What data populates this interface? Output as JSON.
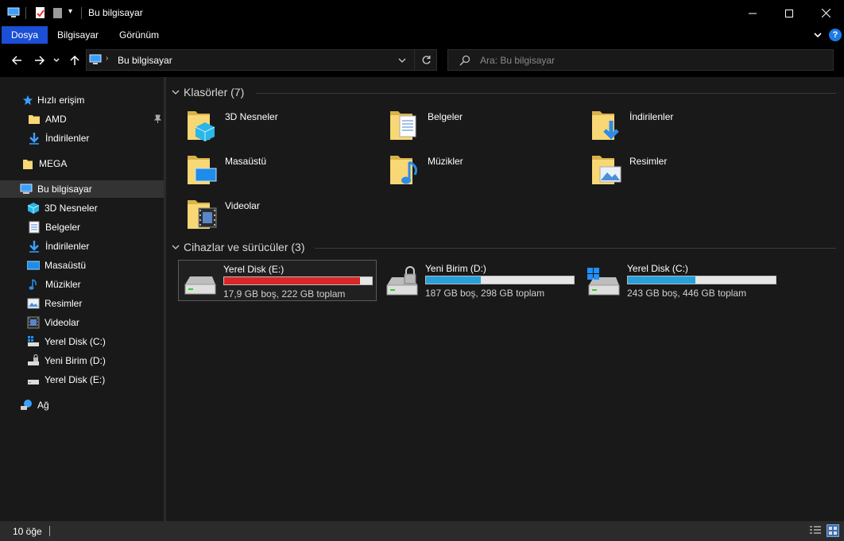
{
  "window": {
    "title": "Bu bilgisayar"
  },
  "ribbon": {
    "tabs": [
      "Dosya",
      "Bilgisayar",
      "Görünüm"
    ]
  },
  "address": {
    "location": "Bu bilgisayar"
  },
  "search": {
    "placeholder": "Ara: Bu bilgisayar"
  },
  "sidebar": {
    "items": [
      {
        "label": "Hızlı erişim",
        "icon": "star-icon"
      },
      {
        "label": "AMD",
        "icon": "folder-icon"
      },
      {
        "label": "İndirilenler",
        "icon": "download-arrow-icon"
      },
      {
        "label": "MEGA",
        "icon": "folder-icon"
      },
      {
        "label": "Bu bilgisayar",
        "icon": "computer-icon"
      },
      {
        "label": "3D Nesneler",
        "icon": "cube-icon"
      },
      {
        "label": "Belgeler",
        "icon": "document-icon"
      },
      {
        "label": "İndirilenler",
        "icon": "download-arrow-icon"
      },
      {
        "label": "Masaüstü",
        "icon": "desktop-icon"
      },
      {
        "label": "Müzikler",
        "icon": "music-note-icon"
      },
      {
        "label": "Resimler",
        "icon": "picture-icon"
      },
      {
        "label": "Videolar",
        "icon": "film-icon"
      },
      {
        "label": "Yerel Disk (C:)",
        "icon": "windows-drive-icon"
      },
      {
        "label": "Yeni Birim (D:)",
        "icon": "locked-drive-icon"
      },
      {
        "label": "Yerel Disk (E:)",
        "icon": "drive-icon"
      },
      {
        "label": "Ağ",
        "icon": "network-icon"
      }
    ]
  },
  "folders": {
    "header": "Klasörler (7)",
    "items": [
      {
        "label": "3D Nesneler",
        "icon": "cube-folder-icon"
      },
      {
        "label": "Belgeler",
        "icon": "documents-folder-icon"
      },
      {
        "label": "İndirilenler",
        "icon": "downloads-folder-icon"
      },
      {
        "label": "Masaüstü",
        "icon": "desktop-folder-icon"
      },
      {
        "label": "Müzikler",
        "icon": "music-folder-icon"
      },
      {
        "label": "Resimler",
        "icon": "pictures-folder-icon"
      },
      {
        "label": "Videolar",
        "icon": "videos-folder-icon"
      }
    ]
  },
  "drives": {
    "header": "Cihazlar ve sürücüler (3)",
    "items": [
      {
        "name": "Yerel Disk (E:)",
        "info": "17,9 GB boş, 222 GB toplam",
        "used_fraction": 0.92,
        "bar_color": "#da2626",
        "icon": "drive-icon"
      },
      {
        "name": "Yeni Birim (D:)",
        "info": "187 GB boş, 298 GB toplam",
        "used_fraction": 0.37,
        "bar_color": "#26a0da",
        "icon": "locked-drive-icon"
      },
      {
        "name": "Yerel Disk (C:)",
        "info": "243 GB boş, 446 GB toplam",
        "used_fraction": 0.455,
        "bar_color": "#26a0da",
        "icon": "windows-drive-icon"
      }
    ]
  },
  "status": {
    "count": "10 öğe"
  },
  "colors": {
    "accent": "#1a4fd6",
    "folder_yellow": "#f8d775",
    "help_blue": "#1e7ae6"
  }
}
